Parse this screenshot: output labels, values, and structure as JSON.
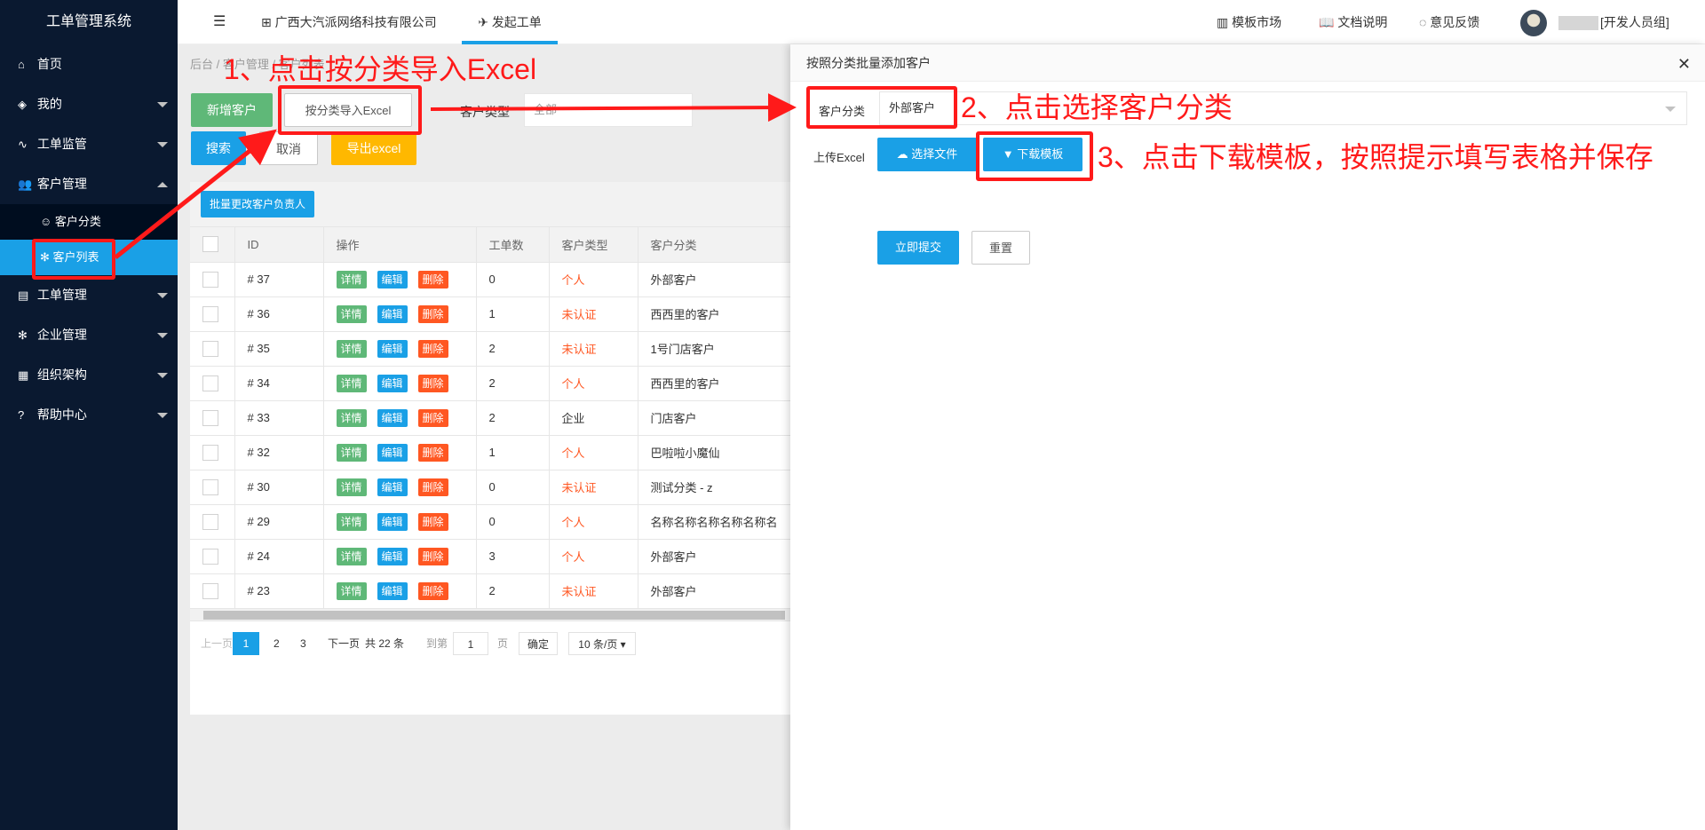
{
  "sidebar": {
    "logo": "工单管理系统",
    "items": [
      {
        "label": "首页",
        "icon": "home-icon"
      },
      {
        "label": "我的",
        "icon": "layers-icon"
      },
      {
        "label": "工单监管",
        "icon": "pulse-icon"
      },
      {
        "label": "客户管理",
        "icon": "users-icon"
      },
      {
        "label": "工单管理",
        "icon": "clipboard-icon"
      },
      {
        "label": "企业管理",
        "icon": "gear-icon"
      },
      {
        "label": "组织架构",
        "icon": "calendar-icon"
      },
      {
        "label": "帮助中心",
        "icon": "question-icon"
      }
    ],
    "sub_items": [
      {
        "label": "客户分类",
        "icon": "user-outline-icon"
      },
      {
        "label": "客户列表",
        "icon": "gear-icon"
      }
    ]
  },
  "header": {
    "company": "广西大汽派网络科技有限公司",
    "tab": "发起工单",
    "links": [
      "模板市场",
      "文档说明",
      "意见反馈"
    ],
    "user_role": "[开发人员组]"
  },
  "content": {
    "breadcrumb": "后台 / 客户管理 / 客户列表",
    "buttons": {
      "add": "新增客户",
      "import": "按分类导入Excel",
      "search": "搜索",
      "cancel": "取消",
      "export": "导出excel",
      "batch": "批量更改客户负责人"
    },
    "filter_label": "客户类型",
    "filter_value": "全部",
    "table": {
      "headers": [
        "ID",
        "操作",
        "工单数",
        "客户类型",
        "客户分类"
      ],
      "action_labels": [
        "详情",
        "编辑",
        "删除"
      ],
      "rows": [
        {
          "id": "# 37",
          "count": "0",
          "type": "个人",
          "category": "外部客户"
        },
        {
          "id": "# 36",
          "count": "1",
          "type": "未认证",
          "category": "西西里的客户"
        },
        {
          "id": "# 35",
          "count": "2",
          "type": "未认证",
          "category": "1号门店客户"
        },
        {
          "id": "# 34",
          "count": "2",
          "type": "个人",
          "category": "西西里的客户"
        },
        {
          "id": "# 33",
          "count": "2",
          "type": "企业",
          "category": "门店客户"
        },
        {
          "id": "# 32",
          "count": "1",
          "type": "个人",
          "category": "巴啦啦小魔仙"
        },
        {
          "id": "# 30",
          "count": "0",
          "type": "未认证",
          "category": "测试分类 - z"
        },
        {
          "id": "# 29",
          "count": "0",
          "type": "个人",
          "category": "名称名称名称名称名称名"
        },
        {
          "id": "# 24",
          "count": "3",
          "type": "个人",
          "category": "外部客户"
        },
        {
          "id": "# 23",
          "count": "2",
          "type": "未认证",
          "category": "外部客户"
        }
      ]
    },
    "pager": {
      "prev": "上一页",
      "pages": [
        "1",
        "2",
        "3"
      ],
      "next": "下一页",
      "total": "共 22 条",
      "goto": "到第",
      "goto_value": "1",
      "page_unit": "页",
      "confirm": "确定",
      "size": "10 条/页"
    }
  },
  "dialog": {
    "title": "按照分类批量添加客户",
    "category_label": "客户分类",
    "category_value": "外部客户",
    "upload_label": "上传Excel",
    "choose_file": "选择文件",
    "download_template": "下载模板",
    "submit": "立即提交",
    "reset": "重置"
  },
  "annotations": {
    "step1": "1、点击按分类导入Excel",
    "step2": "2、点击选择客户分类",
    "step3": "3、点击下载模板，按照提示填写表格并保存"
  },
  "colors": {
    "sidebar_bg": "#0a1930",
    "accent_blue": "#1aa0e6",
    "green": "#5fb878",
    "orange": "#ffb800",
    "danger": "#ff5722",
    "annotation_red": "#ff1a1a"
  }
}
